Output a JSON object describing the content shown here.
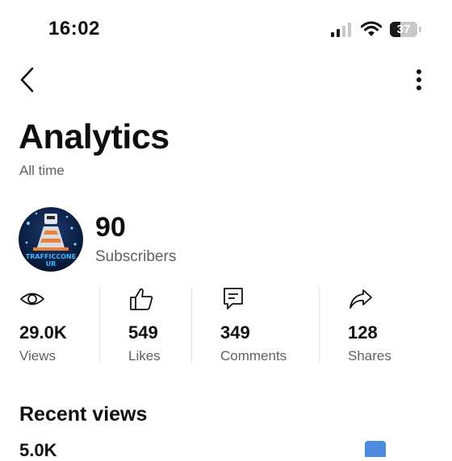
{
  "status_bar": {
    "time": "16:02",
    "battery": "37",
    "battery_level": 0.37
  },
  "header": {
    "title": "Analytics",
    "subtitle": "All time"
  },
  "channel": {
    "avatar_text": "TRAFFICCONE UR",
    "subscriber_count": "90",
    "subscriber_label": "Subscribers"
  },
  "stats": [
    {
      "value": "29.0K",
      "label": "Views",
      "icon": "eye-icon"
    },
    {
      "value": "549",
      "label": "Likes",
      "icon": "thumbs-up-icon"
    },
    {
      "value": "349",
      "label": "Comments",
      "icon": "comment-icon"
    },
    {
      "value": "128",
      "label": "Shares",
      "icon": "share-icon"
    }
  ],
  "recent_views": {
    "title": "Recent views",
    "first_value": "5.0K"
  },
  "colors": {
    "accent_bar": "#4a8bde",
    "secondary_text": "#606060",
    "divider": "#e5e5e5"
  }
}
